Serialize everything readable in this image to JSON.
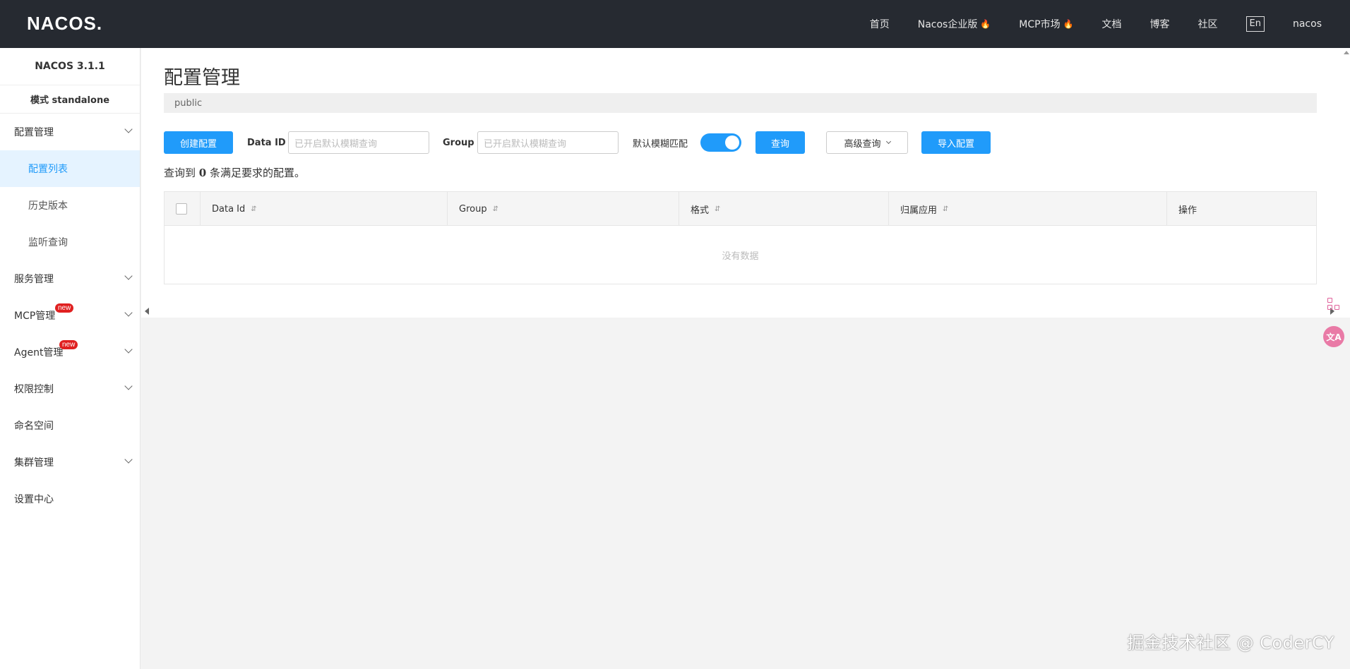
{
  "header": {
    "logo": "NACOS.",
    "nav": [
      {
        "label": "首页",
        "hot": false
      },
      {
        "label": "Nacos企业版",
        "hot": true
      },
      {
        "label": "MCP市场",
        "hot": true
      },
      {
        "label": "文档",
        "hot": false
      },
      {
        "label": "博客",
        "hot": false
      },
      {
        "label": "社区",
        "hot": false
      }
    ],
    "lang": "En",
    "user": "nacos"
  },
  "sidebar": {
    "version": "NACOS 3.1.1",
    "mode": "模式 standalone",
    "items": [
      {
        "label": "配置管理"
      },
      {
        "label": "配置列表"
      },
      {
        "label": "历史版本"
      },
      {
        "label": "监听查询"
      },
      {
        "label": "服务管理"
      },
      {
        "label": "MCP管理",
        "badge": "new"
      },
      {
        "label": "Agent管理",
        "badge": "new"
      },
      {
        "label": "权限控制"
      },
      {
        "label": "命名空间"
      },
      {
        "label": "集群管理"
      },
      {
        "label": "设置中心"
      }
    ]
  },
  "main": {
    "title": "配置管理",
    "namespace": "public",
    "toolbar": {
      "create_label": "创建配置",
      "dataid_label": "Data ID",
      "dataid_placeholder": "已开启默认模糊查询",
      "group_label": "Group",
      "group_placeholder": "已开启默认模糊查询",
      "fuzzy_label": "默认模糊匹配",
      "fuzzy_on": true,
      "search_label": "查询",
      "advanced_label": "高级查询",
      "import_label": "导入配置"
    },
    "summary": {
      "prefix": "查询到 ",
      "count": "0",
      "suffix": " 条满足要求的配置。"
    },
    "table": {
      "columns": [
        "Data Id",
        "Group",
        "格式",
        "归属应用",
        "操作"
      ],
      "sort_icon": "⇵",
      "empty_text": "没有数据"
    }
  },
  "side_tools": {
    "translate_glyph": "文A"
  },
  "watermark": "掘金技术社区 @ CoderCY",
  "colors": {
    "accent": "#209bfa",
    "header_bg": "#262a31",
    "badge": "#e02020"
  }
}
